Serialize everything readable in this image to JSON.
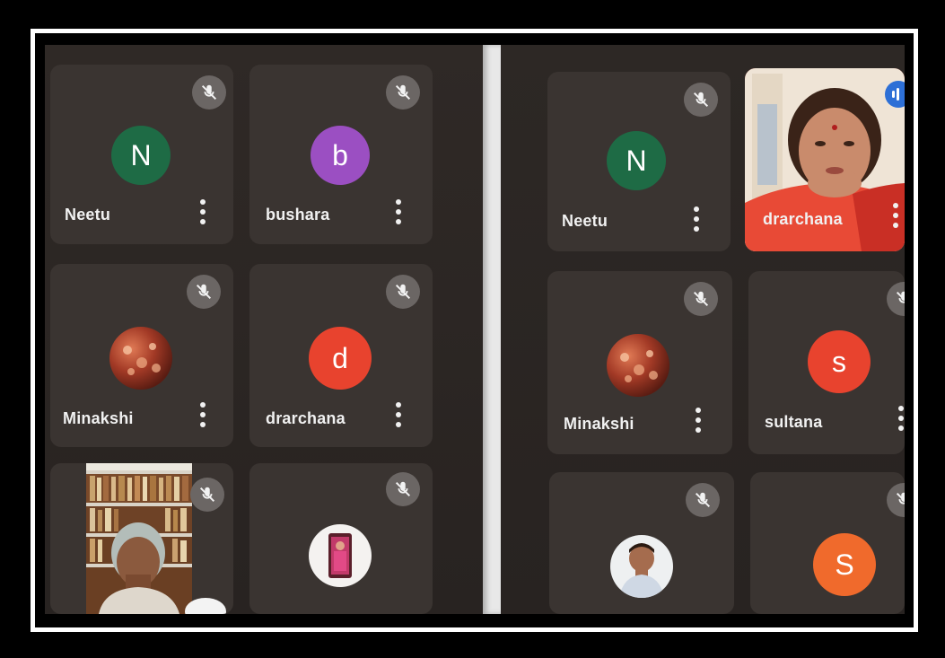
{
  "left_panel": {
    "tiles": [
      {
        "name": "Neetu",
        "initial": "N",
        "avatar_color": "#1e6b45"
      },
      {
        "name": "bushara",
        "initial": "b",
        "avatar_color": "#9b4fc2"
      },
      {
        "name": "Minakshi",
        "initial": "",
        "avatar_color": "#7a2a1d"
      },
      {
        "name": "drarchana",
        "initial": "d",
        "avatar_color": "#e8432e"
      },
      {
        "name": "",
        "initial": "",
        "avatar_color": ""
      },
      {
        "name": "",
        "initial": "",
        "avatar_color": ""
      }
    ]
  },
  "right_panel": {
    "tiles": [
      {
        "name": "Neetu",
        "initial": "N",
        "avatar_color": "#1e6b45"
      },
      {
        "name": "drarchana",
        "initial": "",
        "avatar_color": ""
      },
      {
        "name": "Minakshi",
        "initial": "",
        "avatar_color": "#7a2a1d"
      },
      {
        "name": "sultana",
        "initial": "s",
        "avatar_color": "#e8432e"
      },
      {
        "name": "",
        "initial": "",
        "avatar_color": ""
      },
      {
        "name": "",
        "initial": "S",
        "avatar_color": "#f06a2c"
      }
    ]
  },
  "colors": {
    "tile_bg": "#3a3431",
    "mic_off_bg": "#6b6664",
    "speaking_indicator": "#2d6fd6"
  },
  "icons": {
    "mic_off": "mic-off-icon",
    "more": "more-vert-icon"
  }
}
